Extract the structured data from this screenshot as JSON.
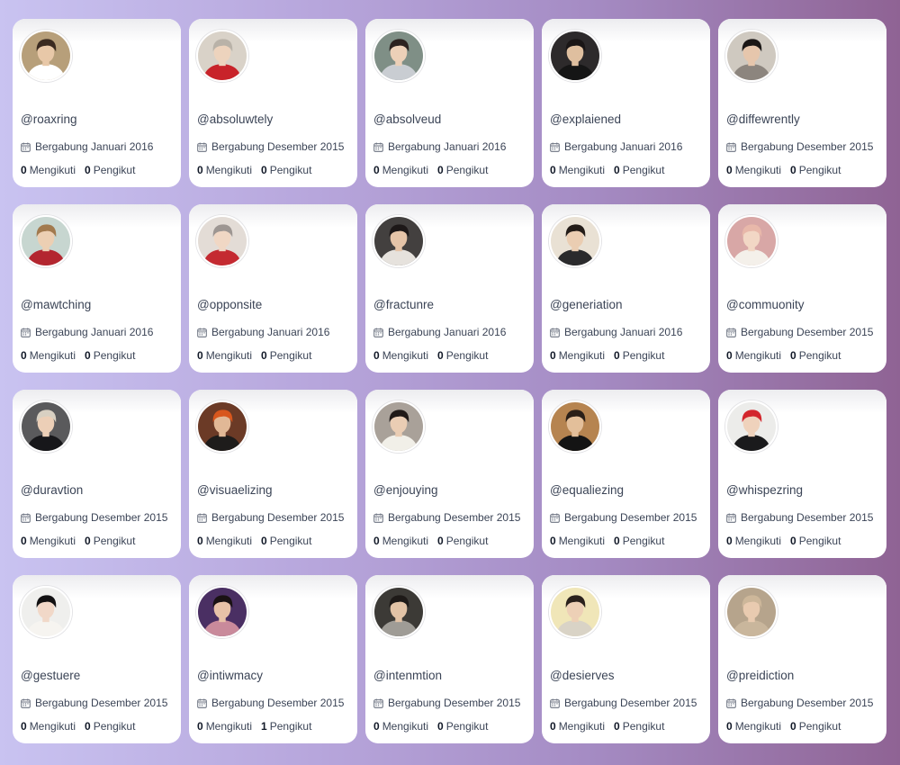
{
  "labels": {
    "following": "Mengikuti",
    "followers": "Pengikut"
  },
  "profiles": [
    {
      "handle": "@roaxring",
      "joined": "Bergabung Januari 2016",
      "following": "0",
      "followers": "0",
      "avatar": {
        "bg": "#b79f7a",
        "hair": "#3a2a20",
        "skin": "#e8c8a8",
        "shirt": "#ffffff"
      }
    },
    {
      "handle": "@absoluwtely",
      "joined": "Bergabung Desember 2015",
      "following": "0",
      "followers": "0",
      "avatar": {
        "bg": "#d9d2c8",
        "hair": "#b9b2a8",
        "skin": "#edd3bd",
        "shirt": "#c8232a"
      }
    },
    {
      "handle": "@absolveud",
      "joined": "Bergabung Januari 2016",
      "following": "0",
      "followers": "0",
      "avatar": {
        "bg": "#7f8f86",
        "hair": "#2b2220",
        "skin": "#ecd0b8",
        "shirt": "#c9cdd2"
      }
    },
    {
      "handle": "@explaiened",
      "joined": "Bergabung Januari 2016",
      "following": "0",
      "followers": "0",
      "avatar": {
        "bg": "#2d2a2b",
        "hair": "#1a1616",
        "skin": "#dfbf9f",
        "shirt": "#151515"
      }
    },
    {
      "handle": "@diffewrently",
      "joined": "Bergabung Desember 2015",
      "following": "0",
      "followers": "0",
      "avatar": {
        "bg": "#cfc9c0",
        "hair": "#1b1716",
        "skin": "#e6c6ac",
        "shirt": "#8c857e"
      }
    },
    {
      "handle": "@mawtching",
      "joined": "Bergabung Januari 2016",
      "following": "0",
      "followers": "0",
      "avatar": {
        "bg": "#c7d6d0",
        "hair": "#a27a4e",
        "skin": "#eccfb3",
        "shirt": "#b3262f"
      }
    },
    {
      "handle": "@opponsite",
      "joined": "Bergabung Januari 2016",
      "following": "0",
      "followers": "0",
      "avatar": {
        "bg": "#e3dcd6",
        "hair": "#9d9692",
        "skin": "#f0d7c4",
        "shirt": "#c42a31"
      }
    },
    {
      "handle": "@fractunre",
      "joined": "Bergabung Januari 2016",
      "following": "0",
      "followers": "0",
      "avatar": {
        "bg": "#43403f",
        "hair": "#1d1818",
        "skin": "#e5c4a8",
        "shirt": "#e6e2dd"
      }
    },
    {
      "handle": "@generiation",
      "joined": "Bergabung Januari 2016",
      "following": "0",
      "followers": "0",
      "avatar": {
        "bg": "#e9e1d4",
        "hair": "#231c18",
        "skin": "#eacdb2",
        "shirt": "#2a2a2c"
      }
    },
    {
      "handle": "@commuonity",
      "joined": "Bergabung Desember 2015",
      "following": "0",
      "followers": "0",
      "avatar": {
        "bg": "#d8a7a6",
        "hair": "#e8b8aa",
        "skin": "#f2d7c5",
        "shirt": "#f4f0ea"
      }
    },
    {
      "handle": "@duravtion",
      "joined": "Bergabung Desember 2015",
      "following": "0",
      "followers": "0",
      "avatar": {
        "bg": "#5a5a5c",
        "hair": "#d8d0c2",
        "skin": "#eccfb7",
        "shirt": "#17171a"
      }
    },
    {
      "handle": "@visuaelizing",
      "joined": "Bergabung Desember 2015",
      "following": "0",
      "followers": "0",
      "avatar": {
        "bg": "#6b3a26",
        "hair": "#d8571d",
        "skin": "#e1b896",
        "shirt": "#1e1c1b"
      }
    },
    {
      "handle": "@enjouying",
      "joined": "Bergabung Desember 2015",
      "following": "0",
      "followers": "0",
      "avatar": {
        "bg": "#a9a199",
        "hair": "#201a18",
        "skin": "#eacdb4",
        "shirt": "#f1efe8"
      }
    },
    {
      "handle": "@equaliezing",
      "joined": "Bergabung Desember 2015",
      "following": "0",
      "followers": "0",
      "avatar": {
        "bg": "#b68450",
        "hair": "#2a1f18",
        "skin": "#e3bf9a",
        "shirt": "#141414"
      }
    },
    {
      "handle": "@whispezring",
      "joined": "Bergabung Desember 2015",
      "following": "0",
      "followers": "0",
      "avatar": {
        "bg": "#ececea",
        "hair": "#d3262c",
        "skin": "#efd2bc",
        "shirt": "#1a1a1c"
      }
    },
    {
      "handle": "@gestuere",
      "joined": "Bergabung Desember 2015",
      "following": "0",
      "followers": "0",
      "avatar": {
        "bg": "#efefed",
        "hair": "#121112",
        "skin": "#f1d8c8",
        "shirt": "#f6f4f0"
      }
    },
    {
      "handle": "@intiwmacy",
      "joined": "Bergabung Desember 2015",
      "following": "0",
      "followers": "1",
      "avatar": {
        "bg": "#4a2f63",
        "hair": "#1a1214",
        "skin": "#e8c2a8",
        "shirt": "#c98a9b"
      }
    },
    {
      "handle": "@intenmtion",
      "joined": "Bergabung Desember 2015",
      "following": "0",
      "followers": "0",
      "avatar": {
        "bg": "#3c3a36",
        "hair": "#1e1a18",
        "skin": "#e2c3a6",
        "shirt": "#9f9c96"
      }
    },
    {
      "handle": "@desierves",
      "joined": "Bergabung Desember 2015",
      "following": "0",
      "followers": "0",
      "avatar": {
        "bg": "#f0e6b8",
        "hair": "#2a211c",
        "skin": "#edd0b6",
        "shirt": "#d9d3c6"
      }
    },
    {
      "handle": "@preidiction",
      "joined": "Bergabung Desember 2015",
      "following": "0",
      "followers": "0",
      "avatar": {
        "bg": "#b6a48c",
        "hair": "#cdb79a",
        "skin": "#e9cbb0",
        "shirt": "#c9b69c"
      }
    }
  ],
  "icons": {
    "calendar": "calendar-icon"
  }
}
